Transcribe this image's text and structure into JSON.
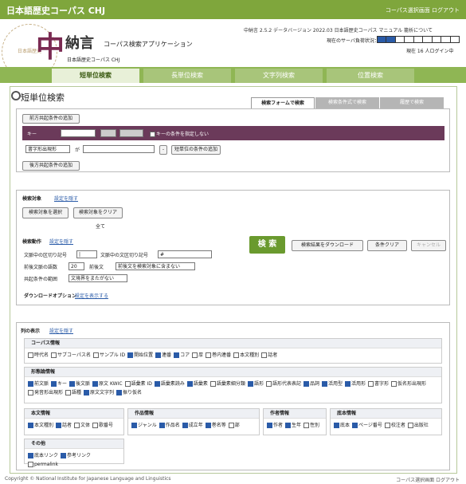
{
  "topbar": {
    "title": "日本語歴史コーパス CHJ",
    "links": "コーパス選択画面 ログアウト"
  },
  "header": {
    "app": "中納言",
    "app_sub": "コーパス検索アプリケーション",
    "corpus": "日本語歴史コーパス CHJ",
    "version": "中納言 2.5.2 データバージョン 2022.03 日本語歴史コーパス マニュアル 籠析について",
    "load_label": "現在のサーバ負荷状況：",
    "users": "現在 16 人ログイン中",
    "watermark": "日本語歴史"
  },
  "tabs": [
    "短単位検索",
    "長単位検索",
    "文字列検索",
    "位置検索"
  ],
  "search": {
    "title": "短単位検索",
    "subtabs": [
      "検索フォームで検索",
      "検索条件式で検索",
      "履歴で検索"
    ],
    "add_front": "前方共起条件の追加",
    "key_label": "キー",
    "key_sel": "- - -",
    "key_cond": "キーの条件を指定しない",
    "gen_sel": "書字形出現形",
    "ga": "が",
    "add_short": "短単位の条件の追加",
    "add_back": "後方共起条件の追加"
  },
  "target": {
    "label": "検索対象",
    "link": "設定を隠す",
    "select": "検索対象を選択",
    "clear": "検索対象をクリア",
    "all": "全て"
  },
  "action": {
    "label": "検索動作",
    "link": "設定を隠す",
    "split_label": "文脈中の区切り記号",
    "split_val": "|",
    "split_label2": "文脈中の文区切り記号",
    "split_val2": "#",
    "ctx_label": "前後文脈の語数",
    "ctx_val": "20",
    "ctx2_label": "前後文",
    "ctx2_val": "前後文を検索対象に含まない",
    "range_label": "共起条件の範囲",
    "range_val": "文境界をまたがない",
    "search": "検 索",
    "download": "検索結果をダウンロード",
    "clear": "条件クリア",
    "cancel": "キャンセル",
    "dl_opt": "ダウンロードオプション",
    "dl_link": "設定を表示する"
  },
  "columns": {
    "label": "列の表示",
    "link": "設定を隠す",
    "groups": [
      {
        "title": "コーパス情報",
        "items": [
          [
            "時代名",
            false
          ],
          [
            "サブコーパス名",
            false
          ],
          [
            "サンプル ID",
            false
          ],
          [
            "開始位置",
            true
          ],
          [
            "連番",
            true
          ],
          [
            "コア",
            true
          ],
          [
            "厚",
            false
          ],
          [
            "巻内連番",
            false
          ],
          [
            "本文種別",
            false
          ],
          [
            "話者",
            false
          ]
        ]
      },
      {
        "title": "形態論情報",
        "items": [
          [
            "前文脈",
            true
          ],
          [
            "キー",
            true
          ],
          [
            "後文脈",
            true
          ],
          [
            "原文 KWIC",
            true
          ],
          [
            "語彙素 ID",
            false
          ],
          [
            "語彙素読み",
            true
          ],
          [
            "語彙素",
            true
          ],
          [
            "語彙素細分類",
            false
          ],
          [
            "語形",
            true
          ],
          [
            "語形代表表記",
            false
          ],
          [
            "品詞",
            true
          ],
          [
            "活用型",
            true
          ],
          [
            "活用形",
            true
          ],
          [
            "書字形",
            false
          ],
          [
            "仮名形出現形",
            false
          ],
          [
            "発音形出現形",
            false
          ],
          [
            "語種",
            false
          ],
          [
            "原文文字列",
            true
          ],
          [
            "振り仮名",
            true
          ]
        ]
      },
      {
        "title": "本文情報",
        "items": [
          [
            "本文種別",
            true
          ],
          [
            "話者",
            true
          ],
          [
            "文体",
            false
          ],
          [
            "歌番号",
            false
          ]
        ]
      },
      {
        "title": "作品情報",
        "items": [
          [
            "ジャンル",
            true
          ],
          [
            "作品名",
            true
          ],
          [
            "成立年",
            true
          ],
          [
            "巻名等",
            true
          ],
          [
            "部",
            false
          ]
        ]
      },
      {
        "title": "作者情報",
        "items": [
          [
            "作者",
            true
          ],
          [
            "生年",
            true
          ],
          [
            "性別",
            false
          ]
        ]
      },
      {
        "title": "底本情報",
        "items": [
          [
            "底本",
            true
          ],
          [
            "ページ番号",
            true
          ],
          [
            "校注者",
            false
          ],
          [
            "出版社",
            false
          ]
        ]
      },
      {
        "title": "その他",
        "items": [
          [
            "底本リンク",
            true
          ],
          [
            "参考リンク",
            true
          ],
          [
            "permalink",
            false
          ]
        ]
      }
    ]
  },
  "footer": {
    "copy": "Copyright © National Institute for Japanese Language and Linguistics",
    "links": "コーパス選択画面 ログアウト"
  }
}
